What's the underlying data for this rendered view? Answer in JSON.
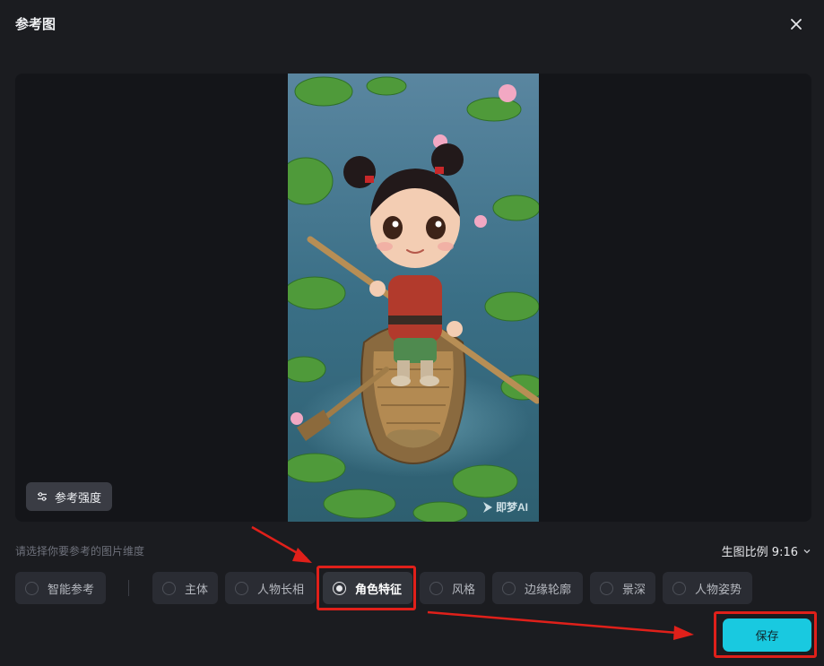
{
  "dialog": {
    "title": "参考图",
    "close_icon": "close-icon"
  },
  "preview": {
    "image_alt": "Cartoon girl rowing a wooden boat among lotus leaves",
    "watermark": "即梦AI",
    "strength_label": "参考强度"
  },
  "options": {
    "hint": "请选择你要参考的图片维度",
    "ratio_label": "生图比例 9:16",
    "smart_label": "智能参考",
    "items": [
      {
        "label": "主体",
        "selected": false
      },
      {
        "label": "人物长相",
        "selected": false
      },
      {
        "label": "角色特征",
        "selected": true
      },
      {
        "label": "风格",
        "selected": false
      },
      {
        "label": "边缘轮廓",
        "selected": false
      },
      {
        "label": "景深",
        "selected": false
      },
      {
        "label": "人物姿势",
        "selected": false
      }
    ]
  },
  "footer": {
    "save_label": "保存"
  },
  "colors": {
    "accent": "#19c9e0",
    "annotation": "#e0201a",
    "background": "#1b1c20"
  }
}
